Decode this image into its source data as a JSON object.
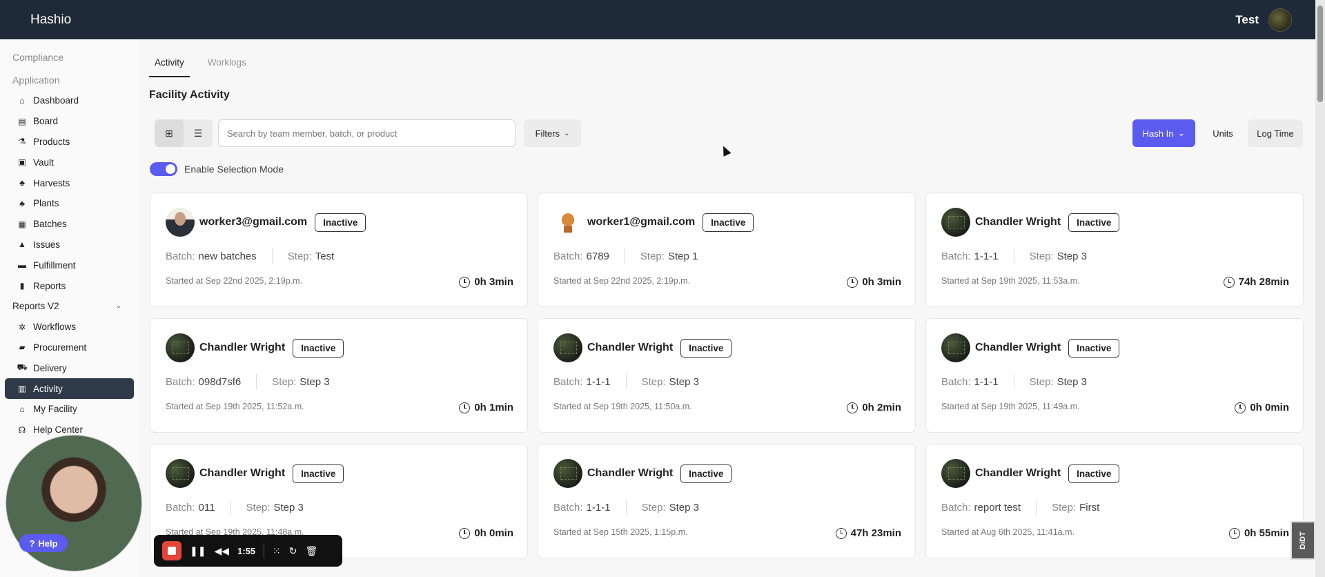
{
  "topbar": {
    "brand": "Hashio",
    "user": "Test"
  },
  "sidebar": {
    "sections": [
      "Compliance",
      "Application"
    ],
    "items": [
      {
        "label": "Dashboard",
        "icon": "home-icon",
        "glyph": "⌂"
      },
      {
        "label": "Board",
        "icon": "board-icon",
        "glyph": "▤"
      },
      {
        "label": "Products",
        "icon": "products-icon",
        "glyph": "⚗"
      },
      {
        "label": "Vault",
        "icon": "vault-icon",
        "glyph": "▣"
      },
      {
        "label": "Harvests",
        "icon": "harvest-icon",
        "glyph": "♣"
      },
      {
        "label": "Plants",
        "icon": "plant-icon",
        "glyph": "♣"
      },
      {
        "label": "Batches",
        "icon": "batches-icon",
        "glyph": "▦"
      },
      {
        "label": "Issues",
        "icon": "warning-icon",
        "glyph": "▲"
      },
      {
        "label": "Fulfillment",
        "icon": "fulfillment-icon",
        "glyph": "▬"
      },
      {
        "label": "Reports",
        "icon": "reports-icon",
        "glyph": "▮"
      },
      {
        "label": "Reports V2",
        "icon": "chevron-down-icon",
        "glyph": "⌄"
      },
      {
        "label": "Workflows",
        "icon": "workflow-icon",
        "glyph": "✲"
      },
      {
        "label": "Procurement",
        "icon": "bag-icon",
        "glyph": "▰"
      },
      {
        "label": "Delivery",
        "icon": "truck-icon",
        "glyph": "⛟"
      },
      {
        "label": "Activity",
        "icon": "activity-icon",
        "glyph": "▥"
      },
      {
        "label": "My Facility",
        "icon": "facility-icon",
        "glyph": "⌂"
      },
      {
        "label": "Help Center",
        "icon": "headset-icon",
        "glyph": "☊"
      }
    ]
  },
  "tabs": [
    {
      "label": "Activity"
    },
    {
      "label": "Worklogs"
    }
  ],
  "page": {
    "title": "Facility Activity"
  },
  "toolbar": {
    "search_placeholder": "Search by team member, batch, or product",
    "filters": "Filters",
    "hash_in": "Hash In",
    "units": "Units",
    "log_time": "Log Time"
  },
  "selection_mode": {
    "label": "Enable Selection Mode",
    "enabled": true
  },
  "labels": {
    "batch": "Batch:",
    "step": "Step:"
  },
  "cards": [
    {
      "name": "worker3@gmail.com",
      "status": "Inactive",
      "avatar": "photo",
      "batch": "new batches",
      "step": "Test",
      "started": "Started at Sep 22nd 2025, 2:19p.m.",
      "duration": "0h 3min"
    },
    {
      "name": "worker1@gmail.com",
      "status": "Inactive",
      "avatar": "trophy",
      "batch": "6789",
      "step": "Step 1",
      "started": "Started at Sep 22nd 2025, 2:19p.m.",
      "duration": "0h 3min"
    },
    {
      "name": "Chandler Wright",
      "status": "Inactive",
      "avatar": "dark",
      "batch": "1-1-1",
      "step": "Step 3",
      "started": "Started at Sep 19th 2025, 11:53a.m.",
      "duration": "74h 28min"
    },
    {
      "name": "Chandler Wright",
      "status": "Inactive",
      "avatar": "dark",
      "batch": "098d7sf6",
      "step": "Step 3",
      "started": "Started at Sep 19th 2025, 11:52a.m.",
      "duration": "0h 1min"
    },
    {
      "name": "Chandler Wright",
      "status": "Inactive",
      "avatar": "dark",
      "batch": "1-1-1",
      "step": "Step 3",
      "started": "Started at Sep 19th 2025, 11:50a.m.",
      "duration": "0h 2min"
    },
    {
      "name": "Chandler Wright",
      "status": "Inactive",
      "avatar": "dark",
      "batch": "1-1-1",
      "step": "Step 3",
      "started": "Started at Sep 19th 2025, 11:49a.m.",
      "duration": "0h 0min"
    },
    {
      "name": "Chandler Wright",
      "status": "Inactive",
      "avatar": "dark",
      "batch": "011",
      "step": "Step 3",
      "started": "Started at Sep 19th 2025, 11:48a.m.",
      "duration": "0h 0min"
    },
    {
      "name": "Chandler Wright",
      "status": "Inactive",
      "avatar": "dark",
      "batch": "1-1-1",
      "step": "Step 3",
      "started": "Started at Sep 15th 2025, 1:15p.m.",
      "duration": "47h 23min"
    },
    {
      "name": "Chandler Wright",
      "status": "Inactive",
      "avatar": "dark",
      "batch": "report test",
      "step": "First",
      "started": "Started at Aug 6th 2025, 11:41a.m.",
      "duration": "0h 55min"
    }
  ],
  "overlay": {
    "help": "Help",
    "recorder_time": "1:55",
    "badge": "DiDT"
  },
  "colors": {
    "accent": "#5b5bf0",
    "topbar": "#1f2a38",
    "sidebar_active": "#2f3a48",
    "record": "#e5443a"
  }
}
